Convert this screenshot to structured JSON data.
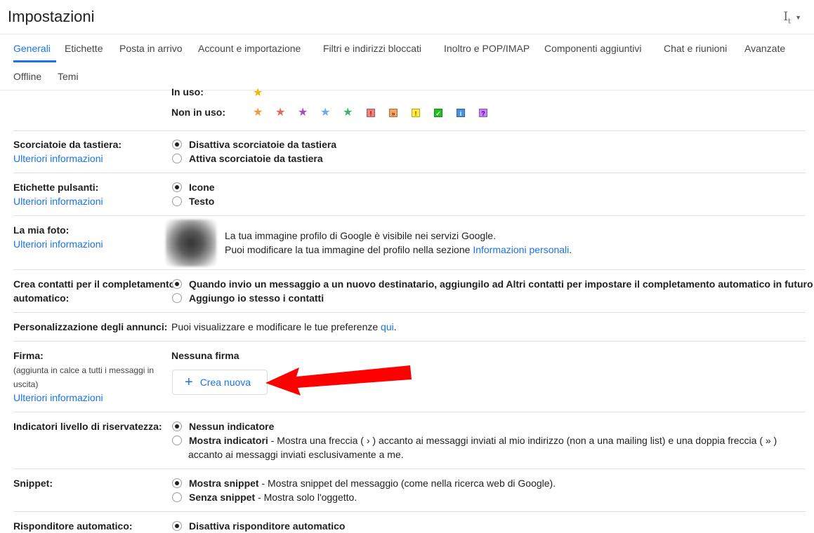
{
  "header": {
    "title": "Impostazioni",
    "density_icon": "text-density-icon"
  },
  "tabs": [
    "Generali",
    "Etichette",
    "Posta in arrivo",
    "Account e importazione",
    "Filtri e indirizzi bloccati",
    "Inoltro e POP/IMAP",
    "Componenti aggiuntivi",
    "Chat e riunioni",
    "Avanzate",
    "Offline",
    "Temi"
  ],
  "stars": {
    "in_use_label": "In uso:",
    "not_in_use_label": "Non in uso:",
    "in_use_icons": [
      "yellow-star-icon"
    ],
    "not_in_use_icons": [
      "orange-star-icon",
      "red-star-icon",
      "purple-star-icon",
      "blue-star-icon",
      "green-star-icon",
      "red-bang-icon",
      "orange-guillemet-icon",
      "yellow-bang-icon",
      "green-check-icon",
      "blue-info-icon",
      "purple-question-icon"
    ]
  },
  "shortcuts": {
    "label": "Scorciatoie da tastiera:",
    "more": "Ulteriori informazioni",
    "opt1": "Disattiva scorciatoie da tastiera",
    "opt2": "Attiva scorciatoie da tastiera"
  },
  "buttons": {
    "label": "Etichette pulsanti:",
    "more": "Ulteriori informazioni",
    "opt1": "Icone",
    "opt2": "Testo"
  },
  "photo": {
    "label": "La mia foto:",
    "more": "Ulteriori informazioni",
    "line1": "La tua immagine profilo di Google è visibile nei servizi Google.",
    "line2": "Puoi modificare la tua immagine del profilo nella sezione",
    "link": "Informazioni personali",
    "line2_end": "."
  },
  "contacts": {
    "label_line1": "Crea contatti per il completamento",
    "label_line2": "automatico:",
    "opt1": "Quando invio un messaggio a un nuovo destinatario, aggiungilo ad Altri contatti per impostare il completamento automatico in futuro",
    "opt2": "Aggiungo io stesso i contatti"
  },
  "ads": {
    "label": "Personalizzazione degli annunci:",
    "text": "Puoi visualizzare e modificare le tue preferenze",
    "link": "qui",
    "end": "."
  },
  "signature": {
    "label": "Firma:",
    "sub": "(aggiunta in calce a tutti i messaggi in uscita)",
    "more": "Ulteriori informazioni",
    "none": "Nessuna firma",
    "create": "Crea nuova",
    "arrow_color": "#ff0000"
  },
  "privacy": {
    "label": "Indicatori livello di riservatezza:",
    "opt1": "Nessun indicatore",
    "opt2_bold": "Mostra indicatori",
    "opt2_rest": " - Mostra una freccia ( › ) accanto ai messaggi inviati al mio indirizzo (non a una mailing list) e una doppia freccia ( » )",
    "opt2_line2": "accanto ai messaggi inviati esclusivamente a me."
  },
  "snippet": {
    "label": "Snippet:",
    "opt1_bold": "Mostra snippet",
    "opt1_rest": " - Mostra snippet del messaggio (come nella ricerca web di Google).",
    "opt2_bold": "Senza snippet",
    "opt2_rest": " - Mostra solo l'oggetto."
  },
  "autoreply": {
    "label": "Risponditore automatico:",
    "opt1": "Disattiva risponditore automatico"
  },
  "colors": {
    "accent": "#1a73e8"
  }
}
